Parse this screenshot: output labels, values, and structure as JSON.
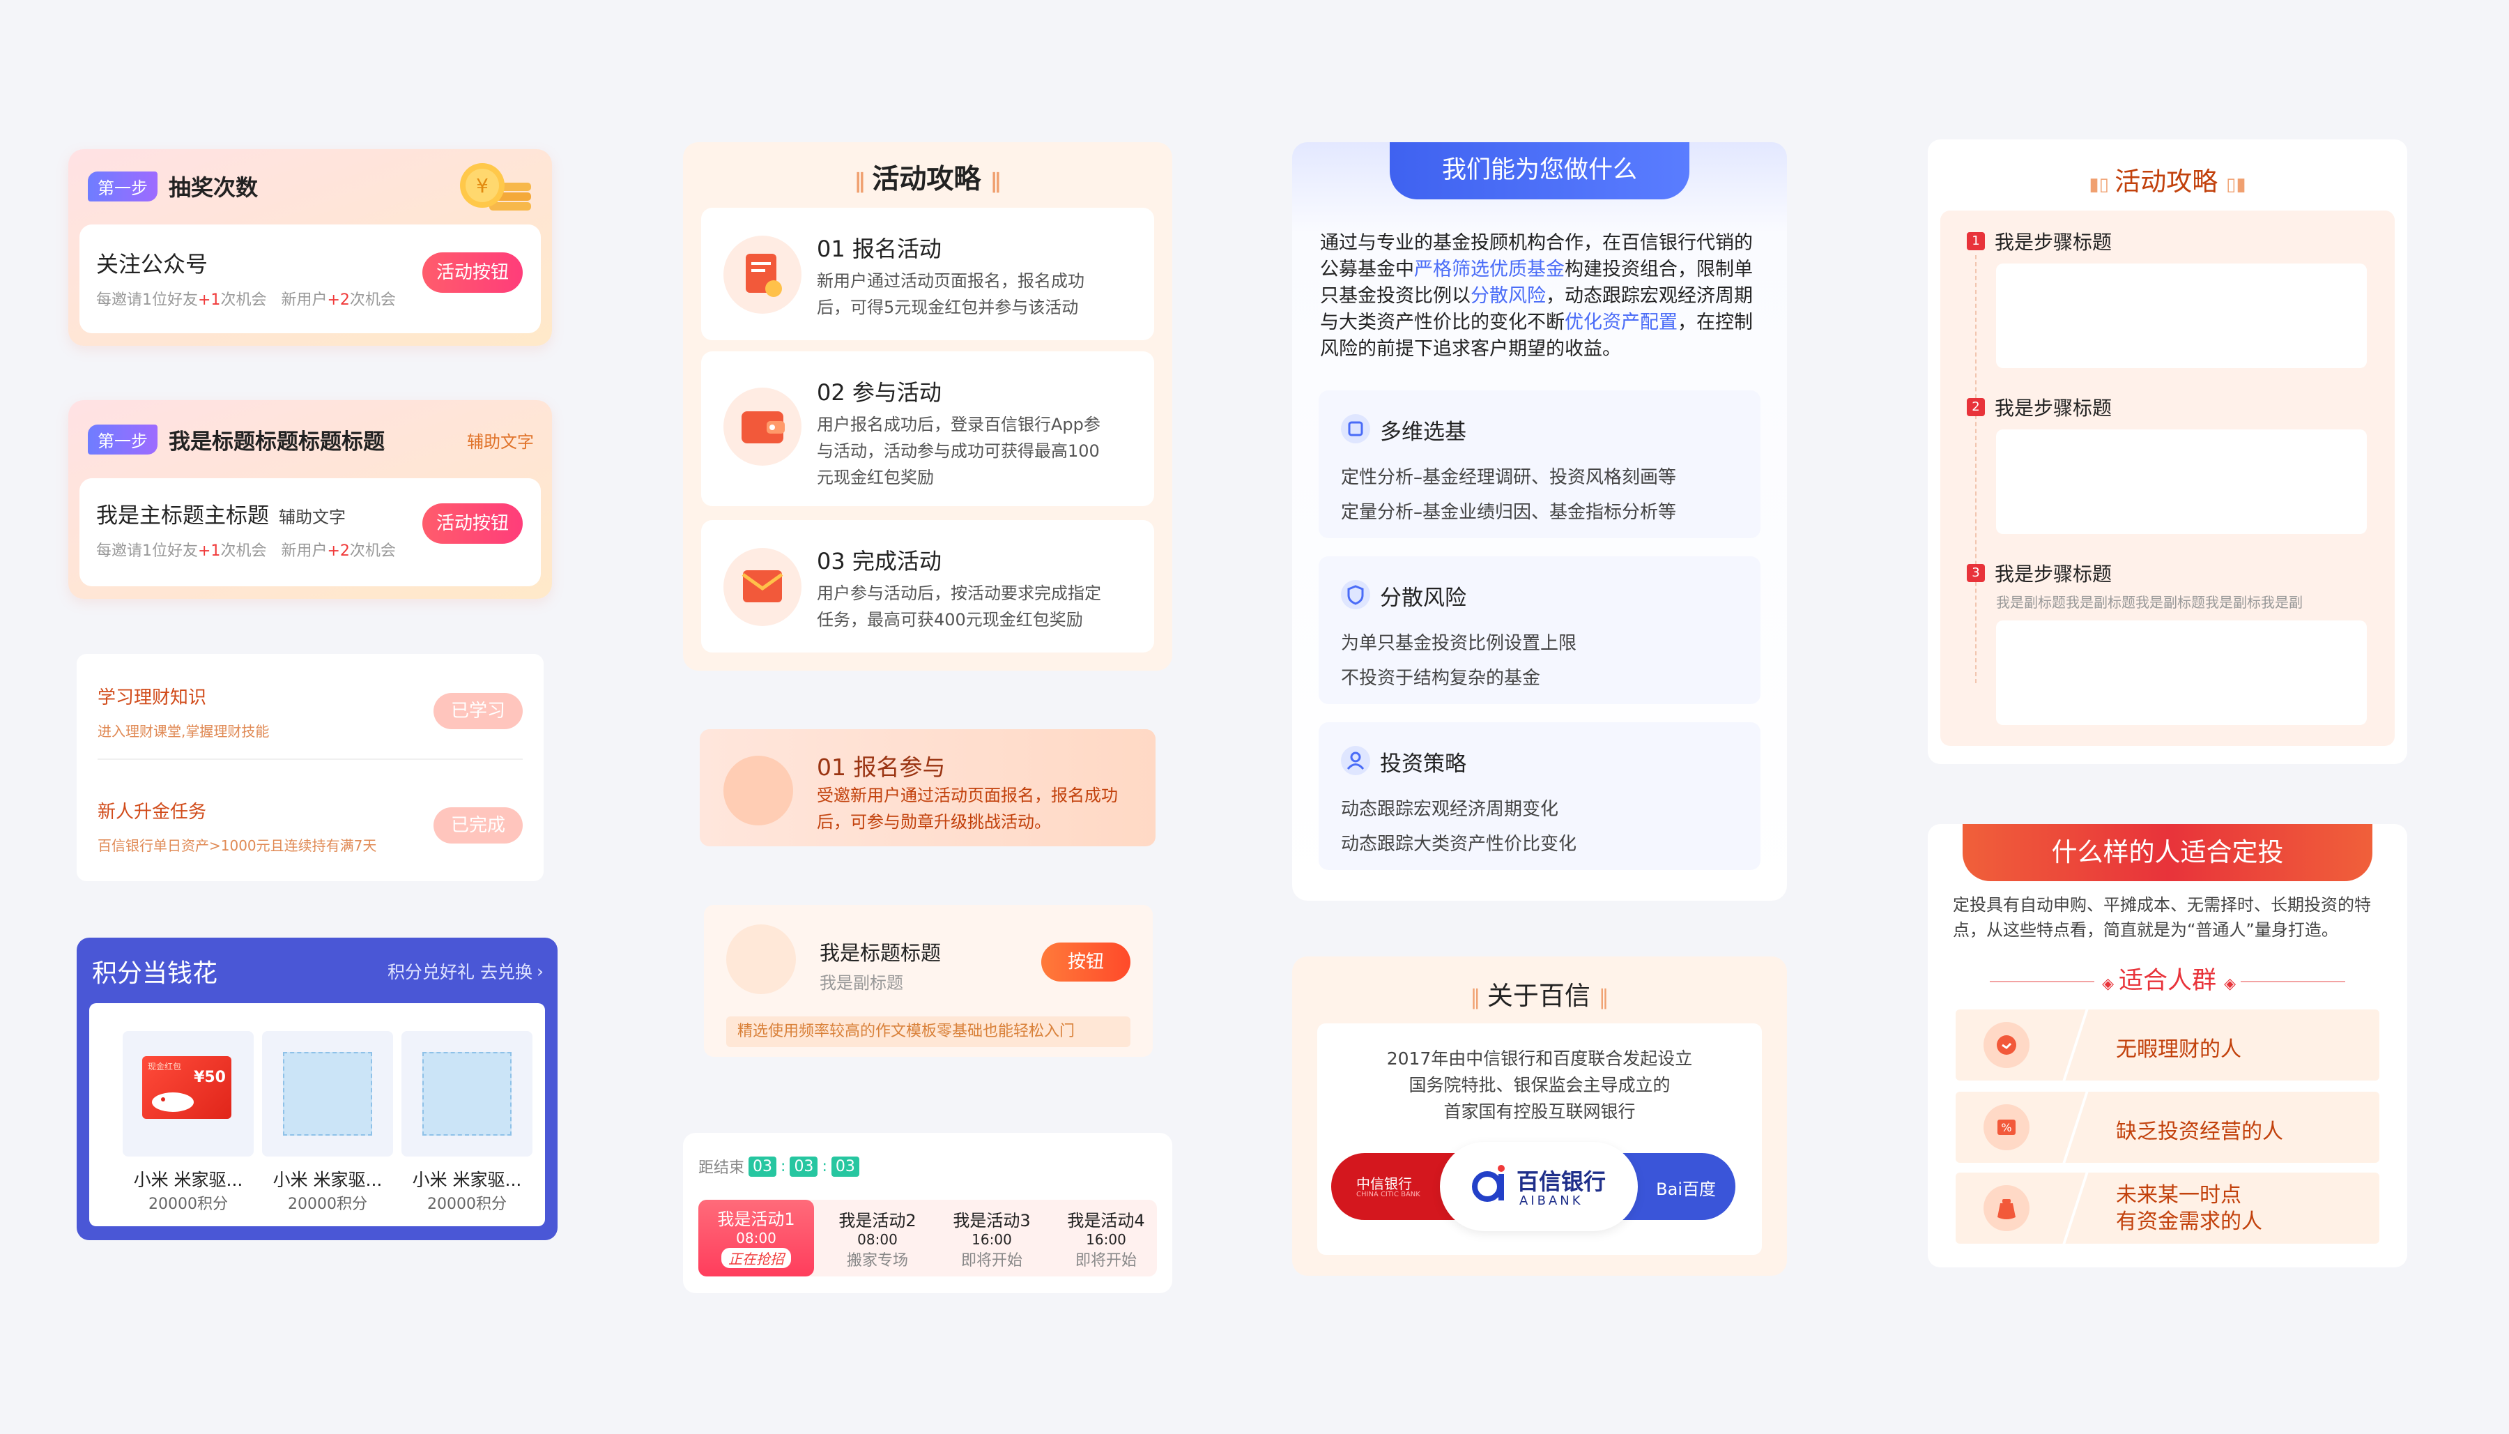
{
  "lottery_card": {
    "step_tag": "第一步",
    "title": "抽奖次数",
    "task_title": "关注公众号",
    "desc_parts": [
      "每邀请1位好友",
      "+1",
      "次机会",
      "新用户",
      "+2",
      "次机会"
    ],
    "button": "活动按钮"
  },
  "title_card": {
    "step_tag": "第一步",
    "title": "我是标题标题标题标题",
    "aux": "辅助文字",
    "main_title": "我是主标题主标题",
    "main_aux": "辅助文字",
    "desc_parts": [
      "每邀请1位好友",
      "+1",
      "次机会",
      "新用户",
      "+2",
      "次机会"
    ],
    "button": "活动按钮"
  },
  "task_list": [
    {
      "title": "学习理财知识",
      "sub": "进入理财课堂,掌握理财技能",
      "status": "已学习"
    },
    {
      "title": "新人升金任务",
      "sub": "百信银行单日资产>1000元且连续持有满7天",
      "status": "已完成"
    }
  ],
  "points": {
    "title": "积分当钱花",
    "link": "积分兑好礼 去兑换",
    "coupon_label": "¥50",
    "coupon_tag": "现金红包",
    "items": [
      {
        "name": "小米 米家驱...",
        "points": "20000积分"
      },
      {
        "name": "小米 米家驱...",
        "points": "20000积分"
      },
      {
        "name": "小米 米家驱...",
        "points": "20000积分"
      }
    ]
  },
  "guide": {
    "title": "活动攻略",
    "steps": [
      {
        "title": "01 报名活动",
        "desc": "新用户通过活动页面报名，报名成功后，可得5元现金红包并参与该活动"
      },
      {
        "title": "02 参与活动",
        "desc": "用户报名成功后，登录百信银行App参与活动，活动参与成功可获得最高100元现金红包奖励"
      },
      {
        "title": "03 完成活动",
        "desc": "用户参与活动后，按活动要求完成指定任务，最高可获400元现金红包奖励"
      }
    ]
  },
  "signup": {
    "title": "01 报名参与",
    "desc": "受邀新用户通过活动页面报名，报名成功后，可参与勋章升级挑战活动。"
  },
  "titlebar_card": {
    "title": "我是标题标题",
    "sub": "我是副标题",
    "button": "按钮",
    "note": "精选使用频率较高的作文模板零基础也能轻松入门"
  },
  "countdown": {
    "label": "距结束",
    "digits": [
      "03",
      "03",
      "03"
    ],
    "sessions": [
      {
        "name": "我是活动1",
        "time": "08:00",
        "status": "正在抢招"
      },
      {
        "name": "我是活动2",
        "time": "08:00",
        "status": "搬家专场"
      },
      {
        "name": "我是活动3",
        "time": "16:00",
        "status": "即将开始"
      },
      {
        "name": "我是活动4",
        "time": "16:00",
        "status": "即将开始"
      }
    ]
  },
  "service": {
    "title": "我们能为您做什么",
    "intro_parts": [
      "通过与专业的基金投顾机构合作，在百信银行代销的公募基金中",
      "严格筛选优质基金",
      "构建投资组合，限制单只基金投资比例以",
      "分散风险",
      "，动态跟踪宏观经济周期与大类资产性价比的变化不断",
      "优化资产配置",
      "，在控制风险的前提下追求客户期望的收益。"
    ],
    "features": [
      {
        "icon": "fund-icon",
        "title": "多维选基",
        "lines": [
          "定性分析–基金经理调研、投资风格刻画等",
          "定量分析–基金业绩归因、基金指标分析等"
        ]
      },
      {
        "icon": "shield-icon",
        "title": "分散风险",
        "lines": [
          "为单只基金投资比例设置上限",
          "不投资于结构复杂的基金"
        ]
      },
      {
        "icon": "person-icon",
        "title": "投资策略",
        "lines": [
          "动态跟踪宏观经济周期变化",
          "动态跟踪大类资产性价比变化"
        ]
      }
    ]
  },
  "about": {
    "title": "关于百信",
    "lines": [
      "2017年由中信银行和百度联合发起设立",
      "国务院特批、银保监会主导成立的",
      "首家国有控股互联网银行"
    ],
    "logo_left": "中信银行",
    "logo_left_sub": "CHINA CITIC BANK",
    "logo_center": "百信银行",
    "logo_center_sub": "AIBANK",
    "logo_right": "Bai百度"
  },
  "guide2": {
    "title": "活动攻略",
    "steps": [
      {
        "num": "1",
        "title": "我是步骤标题",
        "sub": ""
      },
      {
        "num": "2",
        "title": "我是步骤标题",
        "sub": ""
      },
      {
        "num": "3",
        "title": "我是步骤标题",
        "sub": "我是副标题我是副标题我是副标题我是副标我是副"
      }
    ]
  },
  "audience": {
    "title": "什么样的人适合定投",
    "desc": "定投具有自动申购、平摊成本、无需择时、长期投资的特点，从这些特点看，简直就是为“普通人”量身打造。",
    "subtitle": "适合人群",
    "items": [
      {
        "icon": "clock-icon",
        "text": "无暇理财的人"
      },
      {
        "icon": "percent-icon",
        "text": "缺乏投资经营的人"
      },
      {
        "icon": "moneybag-icon",
        "text": "未来某一时点\n有资金需求的人"
      }
    ]
  },
  "colors": {
    "accent_red": "#f03a3a",
    "accent_blue": "#4a6cf7",
    "points_blue": "#4a57d6",
    "button_gradient": "#ff4e6a"
  }
}
